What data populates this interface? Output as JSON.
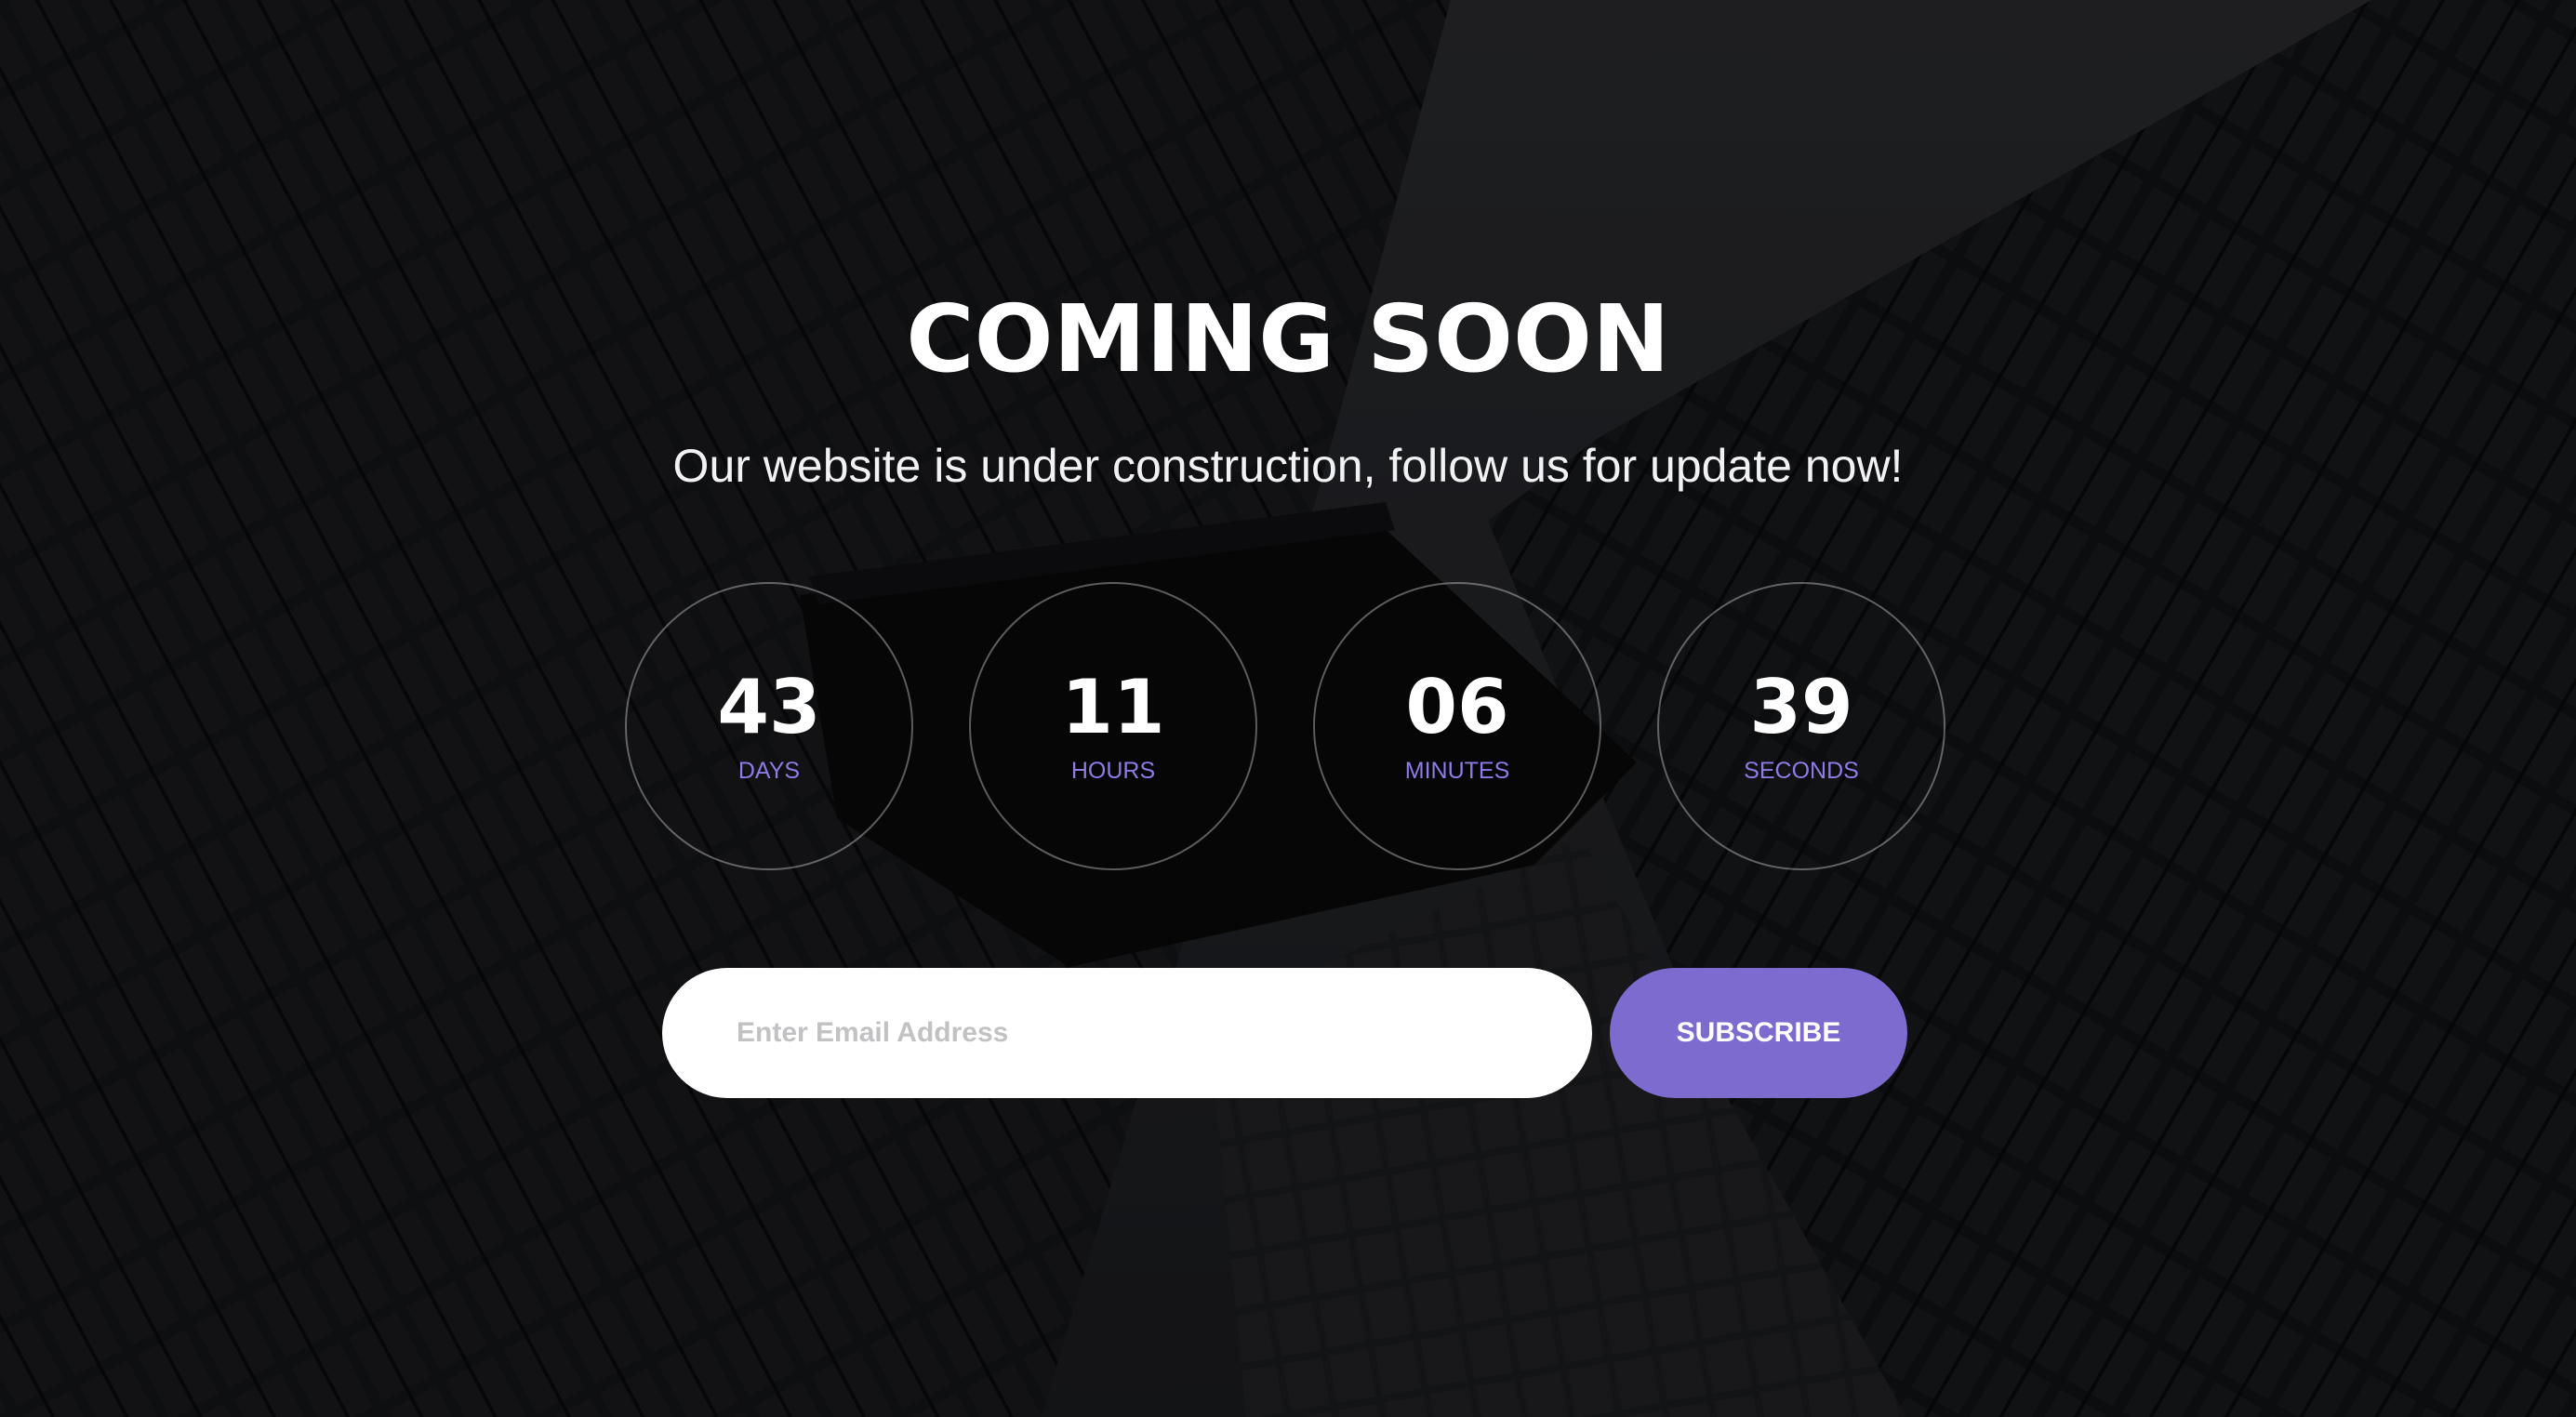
{
  "page": {
    "title": "COMING SOON",
    "subtitle": "Our website is under construction, follow us for update now!"
  },
  "countdown": [
    {
      "value": "43",
      "unit": "DAYS"
    },
    {
      "value": "11",
      "unit": "HOURS"
    },
    {
      "value": "06",
      "unit": "MINUTES"
    },
    {
      "value": "39",
      "unit": "SECONDS"
    }
  ],
  "subscribe_form": {
    "email_placeholder": "Enter Email Address",
    "email_value": "",
    "button_label": "SUBSCRIBE"
  },
  "colors": {
    "accent": "#7d6bd0",
    "unit_text": "#8f7ae6",
    "background": "#141518"
  },
  "background_image": "dark-skyscrapers-photo"
}
